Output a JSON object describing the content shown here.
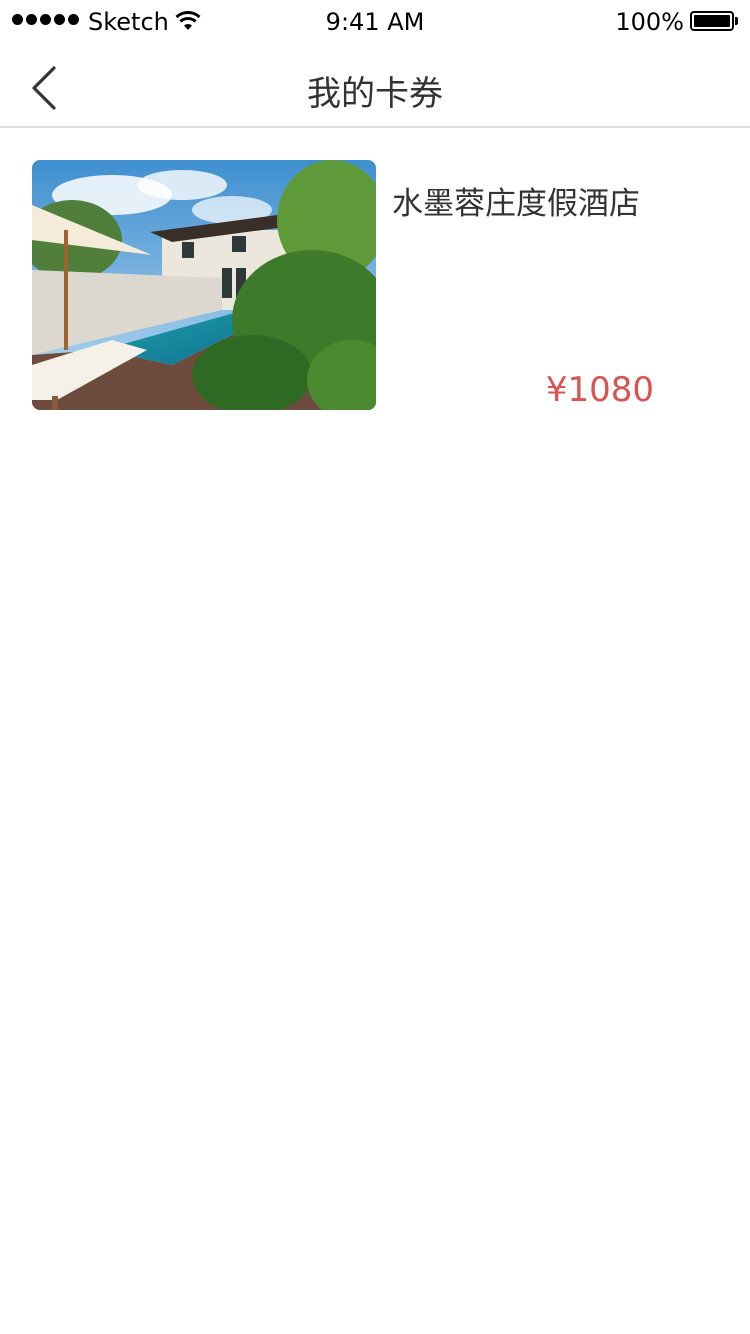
{
  "status_bar": {
    "carrier": "Sketch",
    "time": "9:41 AM",
    "battery_percent": "100%",
    "battery_level": 1.0
  },
  "nav": {
    "title": "我的卡券",
    "back_icon": "chevron-left-icon"
  },
  "cards": [
    {
      "name": "水墨蓉庄度假酒店",
      "price": "¥1080"
    }
  ],
  "colors": {
    "price": "#d9534f",
    "text": "#333333",
    "divider": "#dcdcdc",
    "background": "#ffffff"
  }
}
